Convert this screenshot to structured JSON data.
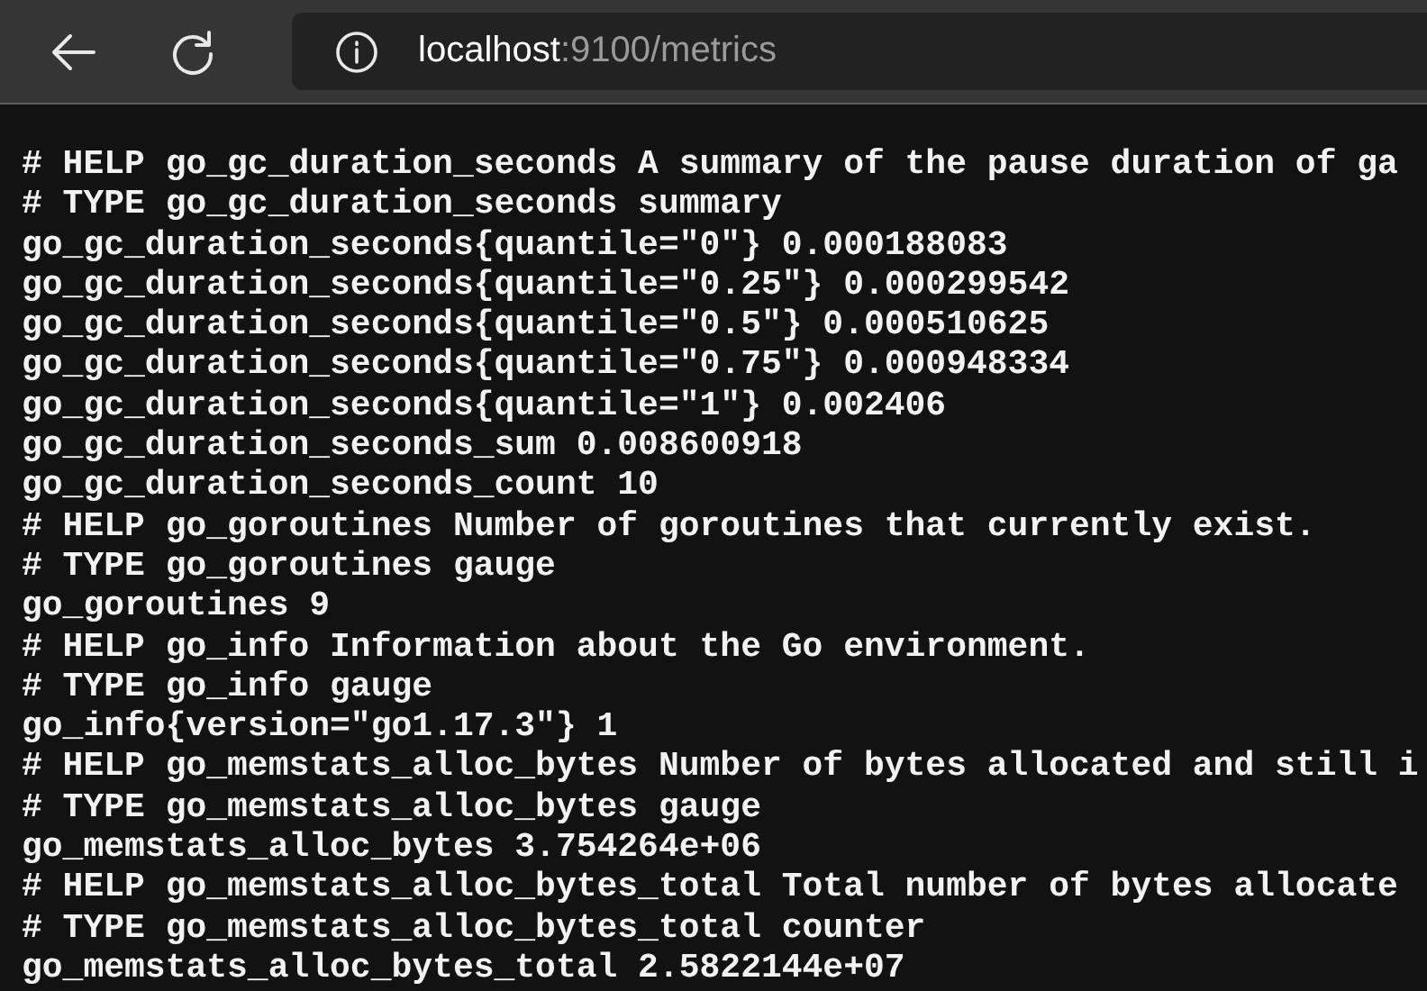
{
  "toolbar": {
    "url_host": "localhost",
    "url_rest": ":9100/metrics"
  },
  "lines": [
    "# HELP go_gc_duration_seconds A summary of the pause duration of ga",
    "# TYPE go_gc_duration_seconds summary",
    "go_gc_duration_seconds{quantile=\"0\"} 0.000188083",
    "go_gc_duration_seconds{quantile=\"0.25\"} 0.000299542",
    "go_gc_duration_seconds{quantile=\"0.5\"} 0.000510625",
    "go_gc_duration_seconds{quantile=\"0.75\"} 0.000948334",
    "go_gc_duration_seconds{quantile=\"1\"} 0.002406",
    "go_gc_duration_seconds_sum 0.008600918",
    "go_gc_duration_seconds_count 10",
    "# HELP go_goroutines Number of goroutines that currently exist.",
    "# TYPE go_goroutines gauge",
    "go_goroutines 9",
    "# HELP go_info Information about the Go environment.",
    "# TYPE go_info gauge",
    "go_info{version=\"go1.17.3\"} 1",
    "# HELP go_memstats_alloc_bytes Number of bytes allocated and still i",
    "# TYPE go_memstats_alloc_bytes gauge",
    "go_memstats_alloc_bytes 3.754264e+06",
    "# HELP go_memstats_alloc_bytes_total Total number of bytes allocate",
    "# TYPE go_memstats_alloc_bytes_total counter",
    "go_memstats_alloc_bytes_total 2.5822144e+07"
  ]
}
